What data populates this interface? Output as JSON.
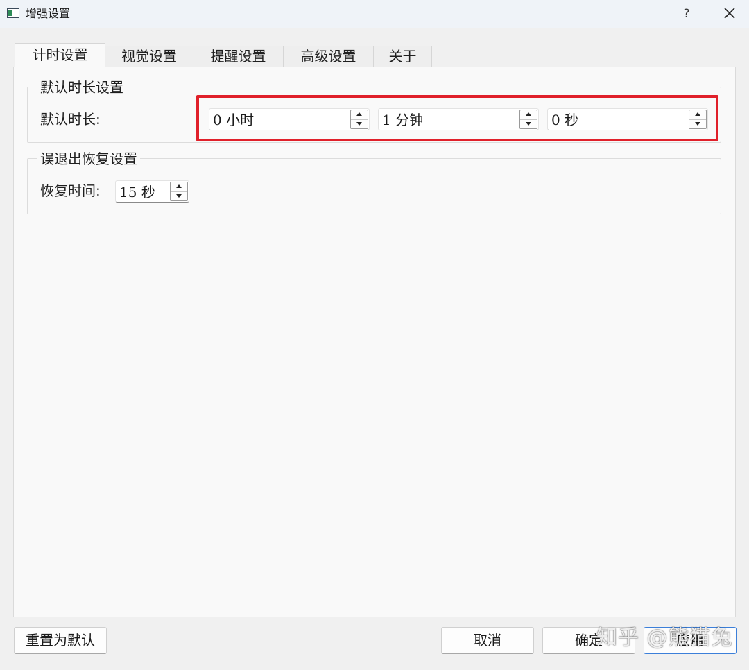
{
  "window": {
    "title": "增强设置",
    "help_label": "?"
  },
  "tabs": [
    {
      "label": "计时设置",
      "active": true
    },
    {
      "label": "视觉设置",
      "active": false
    },
    {
      "label": "提醒设置",
      "active": false
    },
    {
      "label": "高级设置",
      "active": false
    },
    {
      "label": "关于",
      "active": false
    }
  ],
  "default_duration": {
    "group_title": "默认时长设置",
    "label": "默认时长:",
    "hours": {
      "value": "0",
      "unit": "小时"
    },
    "minutes": {
      "value": "1",
      "unit": "分钟"
    },
    "seconds": {
      "value": "0",
      "unit": "秒"
    }
  },
  "exit_recovery": {
    "group_title": "误退出恢复设置",
    "label": "恢复时间:",
    "time": {
      "value": "15",
      "unit": "秒"
    }
  },
  "footer": {
    "reset_label": "重置为默认",
    "cancel_label": "取消",
    "ok_label": "确定",
    "apply_label": "应用"
  },
  "watermark": "知乎 @熊猫兔",
  "colors": {
    "highlight": "#e0202a",
    "primary_border": "#3c7fd9"
  },
  "icons": {
    "close": "close-icon",
    "window": "window-icon"
  }
}
